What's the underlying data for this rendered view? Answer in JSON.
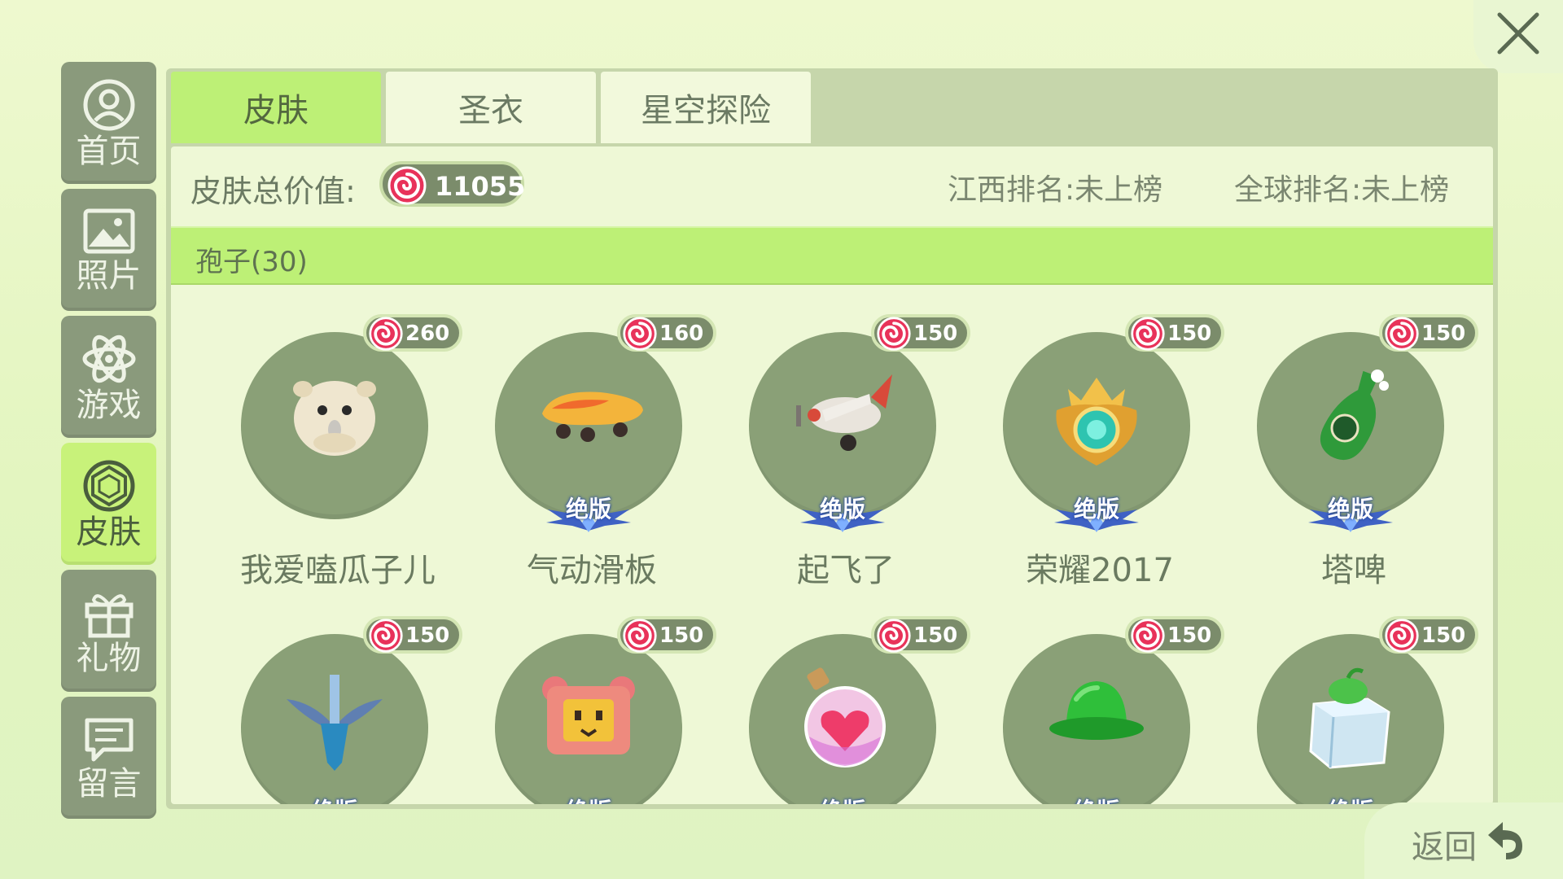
{
  "sidebar": {
    "items": [
      {
        "label": "首页",
        "icon": "user-icon"
      },
      {
        "label": "照片",
        "icon": "photo-icon"
      },
      {
        "label": "游戏",
        "icon": "atom-icon"
      },
      {
        "label": "皮肤",
        "icon": "skin-gem-icon",
        "active": true
      },
      {
        "label": "礼物",
        "icon": "gift-icon"
      },
      {
        "label": "留言",
        "icon": "message-icon"
      }
    ]
  },
  "tabs": [
    {
      "label": "皮肤",
      "active": true
    },
    {
      "label": "圣衣"
    },
    {
      "label": "星空探险"
    }
  ],
  "summary": {
    "total_label": "皮肤总价值:",
    "total_value": "11055",
    "region_rank": "江西排名:未上榜",
    "global_rank": "全球排名:未上榜"
  },
  "category": {
    "label": "孢子(30)"
  },
  "items": [
    {
      "price": "260",
      "name": "我爱嗑瓜子儿",
      "icon": "hamster-icon",
      "badge": ""
    },
    {
      "price": "160",
      "name": "气动滑板",
      "icon": "skateboard-icon",
      "badge": "绝版"
    },
    {
      "price": "150",
      "name": "起飞了",
      "icon": "airplane-icon",
      "badge": "绝版"
    },
    {
      "price": "150",
      "name": "荣耀2017",
      "icon": "crown-emblem-icon",
      "badge": "绝版"
    },
    {
      "price": "150",
      "name": "塔啤",
      "icon": "beer-bottle-icon",
      "badge": "绝版"
    },
    {
      "price": "150",
      "name": "",
      "icon": "sword-icon",
      "badge": "绝版"
    },
    {
      "price": "150",
      "name": "",
      "icon": "bear-box-icon",
      "badge": "绝版"
    },
    {
      "price": "150",
      "name": "",
      "icon": "heart-potion-icon",
      "badge": "绝版"
    },
    {
      "price": "150",
      "name": "",
      "icon": "green-hat-icon",
      "badge": "绝版"
    },
    {
      "price": "150",
      "name": "",
      "icon": "ice-cube-icon",
      "badge": "绝版"
    }
  ],
  "back": {
    "label": "返回"
  },
  "colors": {
    "accent": "#bdf076",
    "panel": "#c6d6ab",
    "circle": "#8aa077",
    "coin": "#e8325a"
  }
}
